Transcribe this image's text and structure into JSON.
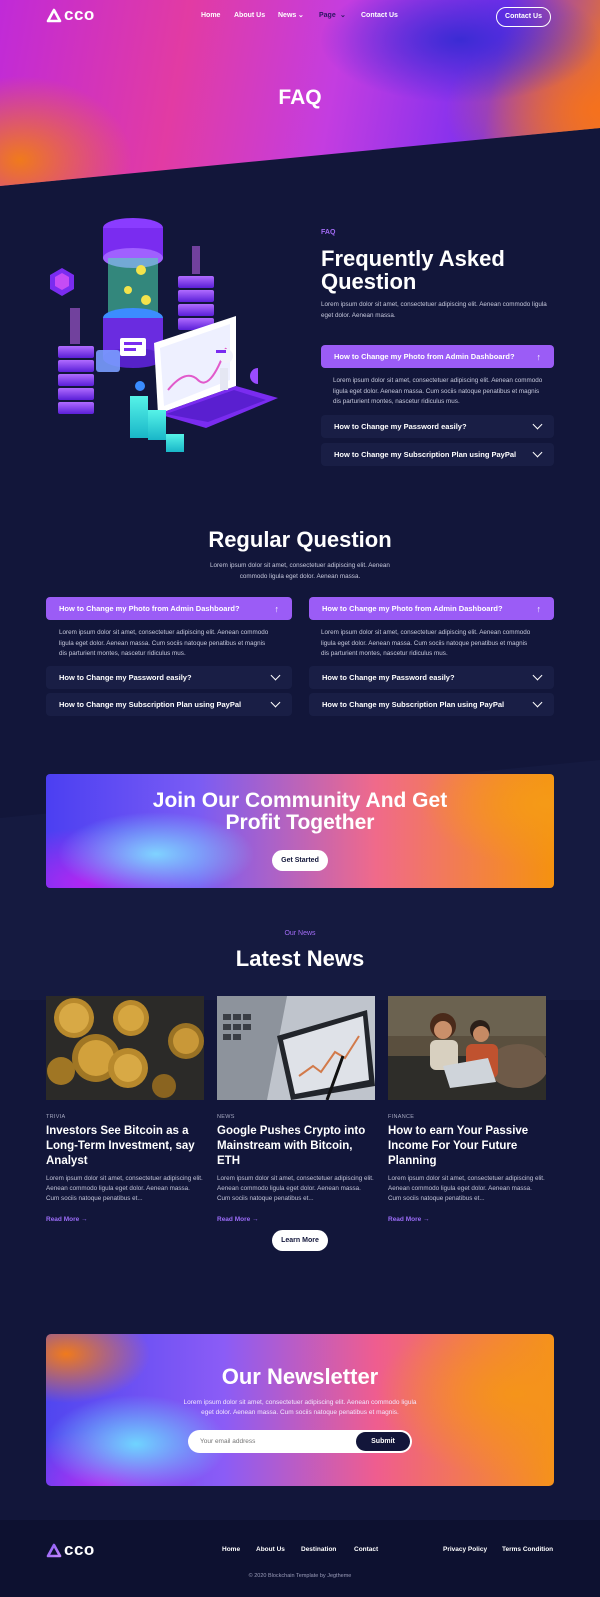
{
  "brand": {
    "name": "cco"
  },
  "nav": {
    "items": [
      "Home",
      "About Us",
      "News",
      "Page",
      "Contact Us"
    ],
    "cta": "Contact Us"
  },
  "hero": {
    "title": "FAQ"
  },
  "faq": {
    "eyebrow": "FAQ",
    "title_line1": "Frequently Asked",
    "title_line2": "Question",
    "intro": "Lorem ipsum dolor sit amet, consectetuer adipiscing elit. Aenean commodo ligula eget dolor. Aenean massa.",
    "items": [
      {
        "q": "How to Change my Photo from Admin Dashboard?",
        "a": "Lorem ipsum dolor sit amet, consectetuer adipiscing elit. Aenean commodo ligula eget dolor. Aenean massa. Cum sociis natoque penatibus et magnis dis parturient montes, nascetur ridiculus mus."
      },
      {
        "q": "How to Change my Password easily?"
      },
      {
        "q": "How to Change my Subscription Plan using PayPal"
      }
    ]
  },
  "regular": {
    "title": "Regular Question",
    "intro_line1": "Lorem ipsum dolor sit amet, consectetuer adipiscing elit. Aenean",
    "intro_line2": "commodo ligula eget dolor. Aenean massa.",
    "left": [
      {
        "q": "How to Change my Photo from Admin Dashboard?",
        "a": "Lorem ipsum dolor sit amet, consectetuer adipiscing elit. Aenean commodo ligula eget dolor. Aenean massa. Cum sociis natoque penatibus et magnis dis parturient montes, nascetur ridiculus mus."
      },
      {
        "q": "How to Change my Password easily?"
      },
      {
        "q": "How to Change my Subscription Plan using PayPal"
      }
    ],
    "right": [
      {
        "q": "How to Change my Photo from Admin Dashboard?",
        "a": "Lorem ipsum dolor sit amet, consectetuer adipiscing elit. Aenean commodo ligula eget dolor. Aenean massa. Cum sociis natoque penatibus et magnis dis parturient montes, nascetur ridiculus mus."
      },
      {
        "q": "How to Change my Password easily?"
      },
      {
        "q": "How to Change my Subscription Plan using PayPal"
      }
    ]
  },
  "community": {
    "title_line1": "Join Our Community And Get",
    "title_line2": "Profit Together",
    "cta": "Get Started"
  },
  "news": {
    "eyebrow": "Our News",
    "title": "Latest News",
    "cards": [
      {
        "tag": "TRIVIA",
        "title": "Investors See Bitcoin as a Long-Term Investment, say Analyst",
        "text": "Lorem ipsum dolor sit amet, consectetuer adipiscing elit. Aenean commodo ligula eget dolor. Aenean massa. Cum sociis natoque penatibus et...",
        "link": "Read More"
      },
      {
        "tag": "NEWS",
        "title": "Google Pushes Crypto into Mainstream with Bitcoin, ETH",
        "text": "Lorem ipsum dolor sit amet, consectetuer adipiscing elit. Aenean commodo ligula eget dolor. Aenean massa. Cum sociis natoque penatibus et...",
        "link": "Read More"
      },
      {
        "tag": "FINANCE",
        "title": "How to earn Your Passive Income For Your Future Planning",
        "text": "Lorem ipsum dolor sit amet, consectetuer adipiscing elit. Aenean commodo ligula eget dolor. Aenean massa. Cum sociis natoque penatibus et...",
        "link": "Read More"
      }
    ],
    "more": "Learn More"
  },
  "newsletter": {
    "title": "Our Newsletter",
    "text_line1": "Lorem ipsum dolor sit amet, consectetuer adipiscing elit. Aenean commodo ligula",
    "text_line2": "eget dolor. Aenean massa. Cum sociis natoque penatibus et magnis.",
    "placeholder": "Your email address",
    "submit": "Submit"
  },
  "footer": {
    "links": [
      "Home",
      "About Us",
      "Destination",
      "Contact"
    ],
    "legal": [
      "Privacy Policy",
      "Terms Condition"
    ],
    "copyright": "© 2020 Blockchain Template by Jegtheme"
  },
  "colors": {
    "bg": "#12163a",
    "accent": "#9b5cf6",
    "card_dark": "#191e45"
  }
}
